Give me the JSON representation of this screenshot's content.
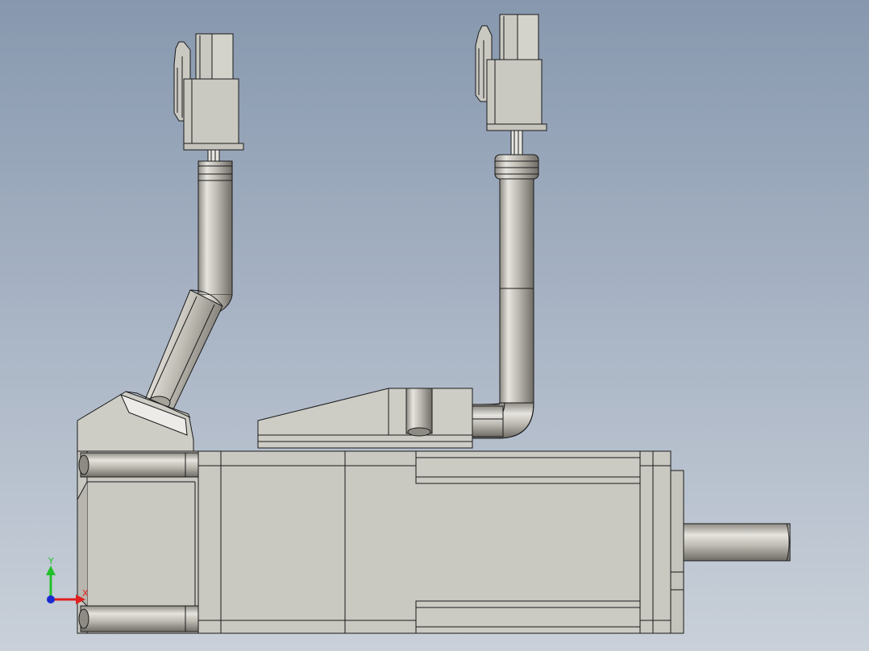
{
  "viewport": {
    "background_top": "#8798ae",
    "background_bottom": "#c9d0d9"
  },
  "model": {
    "body_color": "#c9c8c1",
    "edge_color": "#1a1a1a",
    "cable_color": "#b9b6ad"
  },
  "triad": {
    "y_label": "Y",
    "x_label": "X",
    "y_color": "#22c02a",
    "x_color": "#e02020",
    "z_color": "#1a2ad0"
  }
}
